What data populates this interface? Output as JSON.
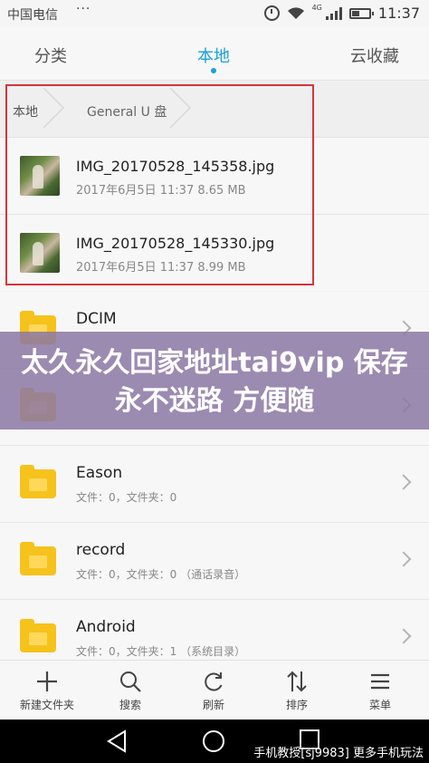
{
  "status_bar": {
    "carrier": "中国电信",
    "more": "···",
    "network_tag": "4G",
    "time": "11:37"
  },
  "tabs": [
    {
      "label": "分类"
    },
    {
      "label": "本地",
      "active": true
    },
    {
      "label": "云收藏"
    }
  ],
  "breadcrumb": [
    {
      "label": "本地"
    },
    {
      "label": "General U 盘"
    }
  ],
  "files": [
    {
      "name": "IMG_20170528_145358.jpg",
      "meta": "2017年6月5日 11:37 8.65 MB"
    },
    {
      "name": "IMG_20170528_145330.jpg",
      "meta": "2017年6月5日 11:37 8.99 MB"
    }
  ],
  "folders": [
    {
      "name": "DCIM",
      "meta": ""
    },
    {
      "name": "Eason",
      "meta": "文件：0，文件夹：0"
    },
    {
      "name": "record",
      "meta": "文件：0，文件夹：0     （通话录音）"
    },
    {
      "name": "Android",
      "meta": "文件：0，文件夹：1     （系统目录）"
    }
  ],
  "overlay": {
    "text": "太久永久回家地址tai9vip 保存永不迷路 方便随"
  },
  "toolbar": [
    {
      "label": "新建文件夹",
      "icon": "plus-icon"
    },
    {
      "label": "搜索",
      "icon": "search-icon"
    },
    {
      "label": "刷新",
      "icon": "refresh-icon"
    },
    {
      "label": "排序",
      "icon": "sort-icon"
    },
    {
      "label": "菜单",
      "icon": "menu-icon"
    }
  ],
  "watermark": "手机教授[sj9983] 更多手机玩法",
  "colors": {
    "accent": "#1aa0d8",
    "folder": "#f6c21c",
    "highlight": "#d6343c",
    "overlay": "#8c78a5"
  }
}
